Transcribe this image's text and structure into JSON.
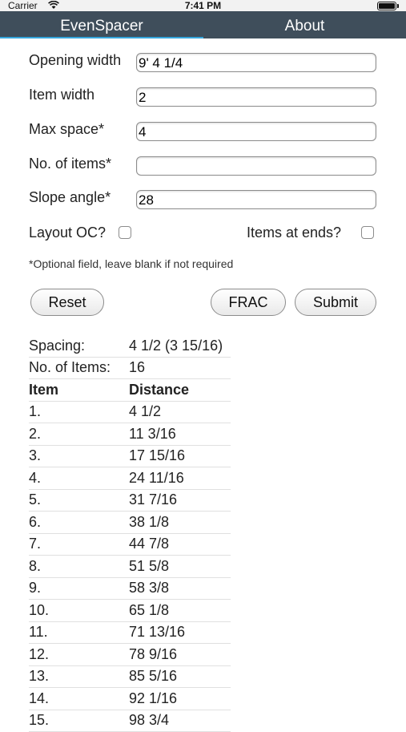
{
  "status": {
    "carrier": "Carrier",
    "time": "7:41 PM"
  },
  "nav": {
    "tabs": [
      "EvenSpacer",
      "About"
    ]
  },
  "form": {
    "opening_width_label": "Opening width",
    "opening_width_value": "9' 4 1/4",
    "item_width_label": "Item width",
    "item_width_value": "2",
    "max_space_label": "Max space*",
    "max_space_value": "4",
    "num_items_label": "No. of items*",
    "num_items_value": "",
    "slope_angle_label": "Slope angle*",
    "slope_angle_value": "28",
    "layout_oc_label": "Layout OC?",
    "items_at_ends_label": "Items at ends?",
    "note": "*Optional field, leave blank if not required"
  },
  "buttons": {
    "reset": "Reset",
    "frac": "FRAC",
    "submit": "Submit"
  },
  "results": {
    "spacing_label": "Spacing:",
    "spacing_value": "4 1/2 (3 15/16)",
    "num_items_label": "No. of Items:",
    "num_items_value": "16",
    "col_item": "Item",
    "col_distance": "Distance",
    "rows": [
      [
        "1.",
        "4 1/2"
      ],
      [
        "2.",
        "11 3/16"
      ],
      [
        "3.",
        "17 15/16"
      ],
      [
        "4.",
        "24 11/16"
      ],
      [
        "5.",
        "31 7/16"
      ],
      [
        "6.",
        "38 1/8"
      ],
      [
        "7.",
        "44 7/8"
      ],
      [
        "8.",
        "51 5/8"
      ],
      [
        "9.",
        "58 3/8"
      ],
      [
        "10.",
        "65 1/8"
      ],
      [
        "11.",
        "71 13/16"
      ],
      [
        "12.",
        "78 9/16"
      ],
      [
        "13.",
        "85 5/16"
      ],
      [
        "14.",
        "92 1/16"
      ],
      [
        "15.",
        "98 3/4"
      ]
    ]
  }
}
